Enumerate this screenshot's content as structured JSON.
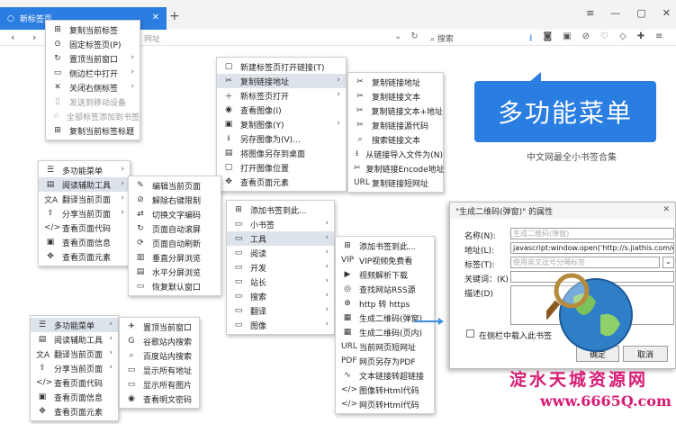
{
  "tab": {
    "title": "新标签页"
  },
  "toolbar": {
    "url": "网址",
    "search_placeholder": "搜索"
  },
  "menu_tab": [
    {
      "icon": "⊞",
      "label": "复制当前标签",
      "arrow": ""
    },
    {
      "icon": "⊙",
      "label": "固定标签页(P)",
      "arrow": ""
    },
    {
      "icon": "↻",
      "label": "置顶当前窗口",
      "arrow": "›"
    },
    {
      "icon": "▭",
      "label": "侧边栏中打开",
      "arrow": "›"
    },
    {
      "icon": "✕",
      "label": "关闭右侧标签",
      "arrow": "›"
    },
    {
      "icon": "▯",
      "label": "发送到移动设备",
      "arrow": "",
      "disabled": true
    },
    {
      "icon": "☆",
      "label": "全部标签添加到书签",
      "arrow": "",
      "disabled": true
    },
    {
      "icon": "⊞",
      "label": "复制当前标签标题",
      "arrow": "›"
    }
  ],
  "menu_link": [
    {
      "icon": "▢",
      "label": "新建标签页打开链接(T)",
      "arrow": ""
    },
    {
      "icon": "✂",
      "label": "复制链接地址",
      "arrow": "›",
      "hl": true
    },
    {
      "icon": "＋",
      "label": "新标签页打开",
      "arrow": "›"
    },
    {
      "icon": "◉",
      "label": "查看图像(I)",
      "arrow": ""
    },
    {
      "icon": "▣",
      "label": "复制图像(Y)",
      "arrow": "›"
    },
    {
      "icon": "⭳",
      "label": "另存图像为(V)...",
      "arrow": ""
    },
    {
      "icon": "▤",
      "label": "将图像另存到桌面",
      "arrow": ""
    },
    {
      "icon": "▢",
      "label": "打开图像位置",
      "arrow": ""
    },
    {
      "icon": "✥",
      "label": "查看页面元素",
      "arrow": ""
    }
  ],
  "menu_copylink": [
    {
      "icon": "✂",
      "label": "复制链接地址"
    },
    {
      "icon": "✂",
      "label": "复制链接文本"
    },
    {
      "icon": "✂",
      "label": "复制链接文本+地址"
    },
    {
      "icon": "✂",
      "label": "复制链接源代码"
    },
    {
      "icon": "⌕",
      "label": "搜索链接文本"
    },
    {
      "icon": "⭳",
      "label": "从链接导入文件为(N)"
    },
    {
      "icon": "✂",
      "label": "复制链接Encode地址"
    },
    {
      "icon": "URL",
      "label": "复制链接短网址"
    }
  ],
  "menu_main": [
    {
      "icon": "☰",
      "label": "多功能菜单",
      "arrow": "›"
    },
    {
      "icon": "▤",
      "label": "阅读辅助工具",
      "arrow": "›",
      "hl": true
    },
    {
      "icon": "文A",
      "label": "翻译当前页面",
      "arrow": "›"
    },
    {
      "icon": "⇪",
      "label": "分享当前页面",
      "arrow": "›"
    },
    {
      "icon": "</>",
      "label": "查看页面代码",
      "arrow": ""
    },
    {
      "icon": "▣",
      "label": "查看页面信息",
      "arrow": ""
    },
    {
      "icon": "✥",
      "label": "查看页面元素",
      "arrow": ""
    }
  ],
  "menu_reading": [
    {
      "icon": "✎",
      "label": "编辑当前页面"
    },
    {
      "icon": "⊘",
      "label": "解除右键限制"
    },
    {
      "icon": "⇄",
      "label": "切换文字编码"
    },
    {
      "icon": "↻",
      "label": "页面自动滚屏"
    },
    {
      "icon": "⟳",
      "label": "页面自动刷新"
    },
    {
      "icon": "▥",
      "label": "垂直分屏浏览"
    },
    {
      "icon": "▤",
      "label": "水平分屏浏览"
    },
    {
      "icon": "▭",
      "label": "恢复默认窗口"
    }
  ],
  "menu_bookmark": [
    {
      "icon": "⊞",
      "label": "添加书签到此...",
      "arrow": ""
    },
    {
      "icon": "▭",
      "label": "小书签",
      "arrow": "›"
    },
    {
      "icon": "▭",
      "label": "工具",
      "arrow": "›",
      "hl": true
    },
    {
      "icon": "▭",
      "label": "阅读",
      "arrow": "›"
    },
    {
      "icon": "▭",
      "label": "开发",
      "arrow": "›"
    },
    {
      "icon": "▭",
      "label": "站长",
      "arrow": "›"
    },
    {
      "icon": "▭",
      "label": "搜索",
      "arrow": "›"
    },
    {
      "icon": "▭",
      "label": "翻译",
      "arrow": "›"
    },
    {
      "icon": "▭",
      "label": "图像",
      "arrow": "›"
    }
  ],
  "menu_tools": [
    {
      "icon": "⊞",
      "label": "添加书签到此..."
    },
    {
      "icon": "VIP",
      "label": "VIP视频免费看"
    },
    {
      "icon": "▶",
      "label": "视频解析下载"
    },
    {
      "icon": "◎",
      "label": "查找网站RSS源"
    },
    {
      "icon": "⊕",
      "label": "http 转 https"
    },
    {
      "icon": "▦",
      "label": "生成二维码(弹窗)"
    },
    {
      "icon": "▦",
      "label": "生成二维码(页内)"
    },
    {
      "icon": "URL",
      "label": "当前网页短网址"
    },
    {
      "icon": "PDF",
      "label": "网页另存为PDF"
    },
    {
      "icon": "∿",
      "label": "文本链接转超链接"
    },
    {
      "icon": "</>",
      "label": "图像转Html代码"
    },
    {
      "icon": "</>",
      "label": "网页转Html代码"
    }
  ],
  "menu_multi": [
    {
      "icon": "☰",
      "label": "多功能菜单",
      "arrow": "›",
      "hl": true
    },
    {
      "icon": "▤",
      "label": "阅读辅助工具",
      "arrow": "›"
    },
    {
      "icon": "文A",
      "label": "翻译当前页面",
      "arrow": "›"
    },
    {
      "icon": "⇪",
      "label": "分享当前页面",
      "arrow": "›"
    },
    {
      "icon": "</>",
      "label": "查看页面代码",
      "arrow": ""
    },
    {
      "icon": "▣",
      "label": "查看页面信息",
      "arrow": ""
    },
    {
      "icon": "✥",
      "label": "查看页面元素",
      "arrow": ""
    }
  ],
  "menu_multi_sub": [
    {
      "icon": "✈",
      "label": "置顶当前窗口"
    },
    {
      "icon": "G",
      "label": "谷歌站内搜索"
    },
    {
      "icon": "⌕",
      "label": "百度站内搜索"
    },
    {
      "icon": "▭",
      "label": "显示所有地址"
    },
    {
      "icon": "▭",
      "label": "显示所有图片"
    },
    {
      "icon": "◉",
      "label": "查看明文密码"
    }
  ],
  "logo": {
    "text": "多功能菜单",
    "caption": "中文网最全小书签合集"
  },
  "dialog": {
    "title": "\"生成二维码(弹窗)\" 的属性",
    "close": "✕",
    "name_label": "名称(N):",
    "name_value": "生成二维码(弹窗)",
    "url_label": "地址(L):",
    "url_value": "javascript:window.open('http://s.jiathis.com/q",
    "tag_label": "标签(T):",
    "tag_value": "使用英文逗号分隔标签",
    "keyword_label": "关键词：(K)",
    "keyword_value": "",
    "desc_label": "描述(D)",
    "desc_value": "",
    "sidebar_label": "在侧栏中载入此书签",
    "ok": "确定",
    "cancel": "取消"
  },
  "watermark": {
    "line1": "淀水天城资源网",
    "line2": "www.6665Q.com"
  }
}
